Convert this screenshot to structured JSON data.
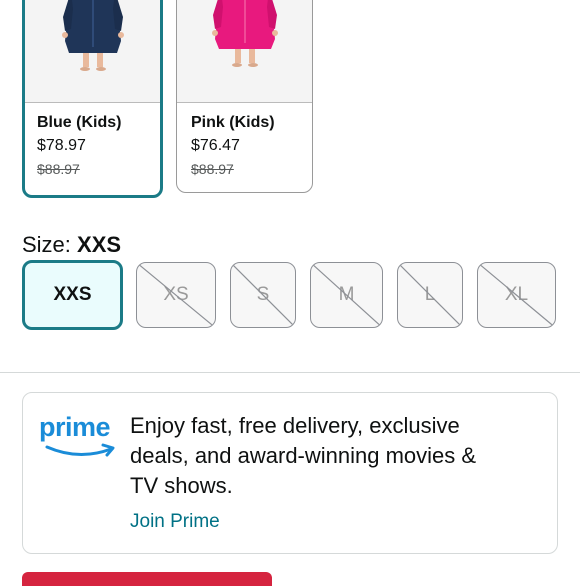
{
  "colors": [
    {
      "name": "Blue (Kids)",
      "price": "$78.97",
      "was": "$88.97",
      "selected": true,
      "icon": "blue-robe-image",
      "accent": "#1f3558"
    },
    {
      "name": "Pink (Kids)",
      "price": "$76.47",
      "was": "$88.97",
      "selected": false,
      "icon": "pink-robe-image",
      "accent": "#e8197e"
    }
  ],
  "size": {
    "label": "Size:",
    "value": "XXS",
    "options": [
      {
        "label": "XXS",
        "available": true,
        "selected": true
      },
      {
        "label": "XS",
        "available": false,
        "selected": false
      },
      {
        "label": "S",
        "available": false,
        "selected": false
      },
      {
        "label": "M",
        "available": false,
        "selected": false
      },
      {
        "label": "L",
        "available": false,
        "selected": false
      },
      {
        "label": "XL",
        "available": false,
        "selected": false
      }
    ]
  },
  "prime": {
    "logo": "prime",
    "line1": "Enjoy fast, free delivery, exclusive",
    "line2": "deals, and award-winning movies &",
    "line3": "TV shows.",
    "link": "Join Prime",
    "logo_color": "#1a8cd8"
  },
  "theme": {
    "selected_border": "#1b7b87",
    "link": "#007185",
    "cta": "#d5243f"
  }
}
